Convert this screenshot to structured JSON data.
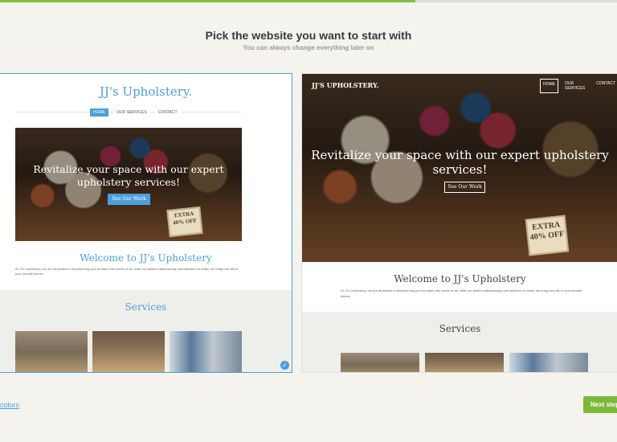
{
  "progress": 0.673,
  "header": {
    "title": "Pick the website you want to start with",
    "subtitle": "You can always change everything later on"
  },
  "template_a": {
    "logo": "JJ's Upholstery.",
    "nav": [
      "HOME",
      "OUR SERVICES",
      "CONTACT"
    ],
    "hero_text": "Revitalize your space with our expert upholstery services!",
    "hero_button": "See Our Work",
    "tag_line1": "EXTRA",
    "tag_line2": "40% OFF",
    "welcome": "Welcome to JJ's Upholstery",
    "body": "At JJ's Upholstery, we are dedicated to transforming your furniture into works of art. With our skilled craftsmanship and attention to detail, we bring new life to your favorite pieces.",
    "services_title": "Services",
    "selected_icon": "check-icon"
  },
  "template_b": {
    "logo": "JJ'S UPHOLSTERY.",
    "nav": [
      "HOME",
      "OUR SERVICES",
      "CONTACT"
    ],
    "hero_text": "Revitalize your space with our expert upholstery services!",
    "hero_button": "See Our Work",
    "tag_line1": "EXTRA",
    "tag_line2": "40% OFF",
    "welcome": "Welcome to JJ's Upholstery",
    "body": "At JJ's Upholstery, we are dedicated to transforming your furniture into works of art. With our skilled craftsmanship and attention to detail, we bring new life to your favorite pieces.",
    "services_title": "Services"
  },
  "footer": {
    "colors_link": "colors",
    "next_button": "Next step"
  },
  "colors": {
    "accent": "#4a9fdc",
    "progress": "#7fc242",
    "next": "#7bb83a"
  }
}
